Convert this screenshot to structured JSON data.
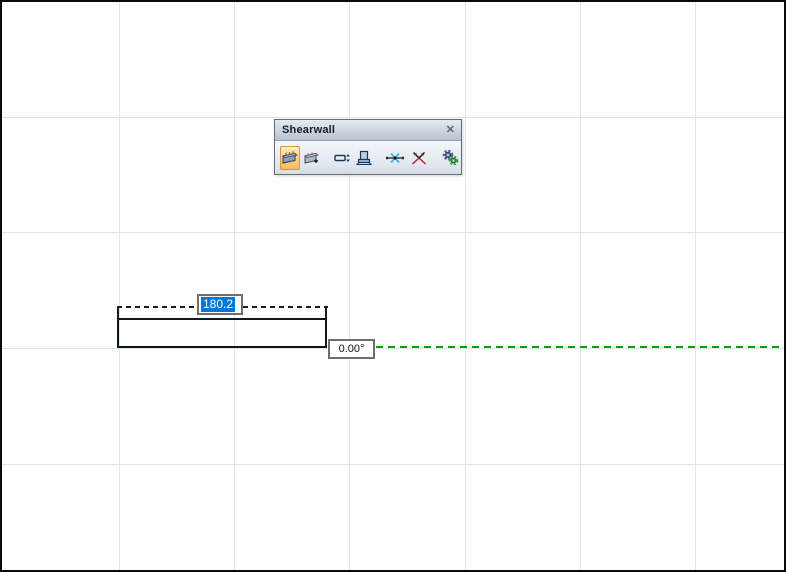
{
  "window": {
    "background": "#ffffff",
    "grid_color": "#e3e4e9",
    "border_color": "#06090d"
  },
  "toolbar": {
    "title": "Shearwall",
    "close_icon_glyph": "✕",
    "buttons": [
      {
        "icon": "shearwall-draw-icon",
        "selected": true
      },
      {
        "icon": "shearwall-add-icon",
        "selected": false
      },
      {
        "icon": "wall-dimension-icon",
        "selected": false
      },
      {
        "icon": "column-base-icon",
        "selected": false
      },
      {
        "icon": "axis-snap-icon",
        "selected": false
      },
      {
        "icon": "axis-delete-icon",
        "selected": false
      },
      {
        "icon": "settings-gears-icon",
        "selected": false
      }
    ],
    "selected_button_colors": {
      "top": "#ffefbd",
      "bottom": "#f9b95b",
      "border": "#cb9a42"
    }
  },
  "drawing": {
    "dimension_input": {
      "value": "180.2",
      "selection_color": "#0078d7",
      "text_color": "#ffffff"
    },
    "angle_readout": {
      "value": "0.00°"
    },
    "alignment_line_color": "#00a400",
    "dimension_line_color": "#1c1c1c",
    "wall_outline_color": "#10161e"
  }
}
